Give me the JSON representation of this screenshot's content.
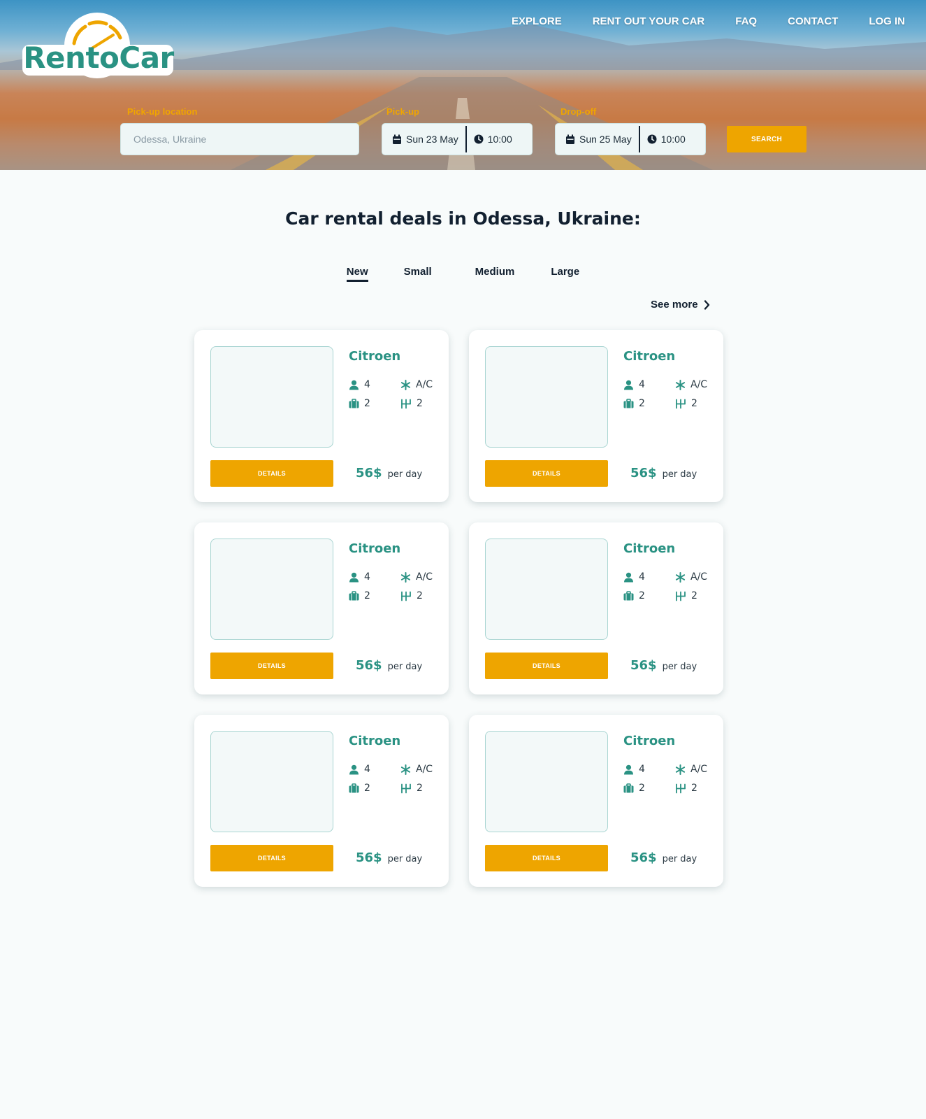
{
  "brand": {
    "name": "RentoCar"
  },
  "nav": {
    "items": [
      "EXPLORE",
      "RENT OUT YOUR CAR",
      "FAQ",
      "CONTACT",
      "LOG IN"
    ]
  },
  "search": {
    "pickup_location_label": "Pick-up location",
    "pickup_location_value": "Odessa, Ukraine",
    "pickup_label": "Pick-up",
    "pickup_date": "Sun 23 May",
    "pickup_time": "10:00",
    "dropoff_label": "Drop-off",
    "dropoff_date": "Sun 25 May",
    "dropoff_time": "10:00",
    "button_label": "SEARCH"
  },
  "main": {
    "heading": "Car rental deals in Odessa, Ukraine:",
    "tabs": [
      "New",
      "Small",
      "Medium",
      "Large"
    ],
    "active_tab": "New",
    "see_more": "See more"
  },
  "cars": [
    {
      "name": "Citroen",
      "seats": "4",
      "ac": "A/C",
      "bags": "2",
      "gears": "2",
      "details_label": "DETAILS",
      "price": "56$",
      "per": "per day"
    },
    {
      "name": "Citroen",
      "seats": "4",
      "ac": "A/C",
      "bags": "2",
      "gears": "2",
      "details_label": "DETAILS",
      "price": "56$",
      "per": "per day"
    },
    {
      "name": "Citroen",
      "seats": "4",
      "ac": "A/C",
      "bags": "2",
      "gears": "2",
      "details_label": "DETAILS",
      "price": "56$",
      "per": "per day"
    },
    {
      "name": "Citroen",
      "seats": "4",
      "ac": "A/C",
      "bags": "2",
      "gears": "2",
      "details_label": "DETAILS",
      "price": "56$",
      "per": "per day"
    },
    {
      "name": "Citroen",
      "seats": "4",
      "ac": "A/C",
      "bags": "2",
      "gears": "2",
      "details_label": "DETAILS",
      "price": "56$",
      "per": "per day"
    },
    {
      "name": "Citroen",
      "seats": "4",
      "ac": "A/C",
      "bags": "2",
      "gears": "2",
      "details_label": "DETAILS",
      "price": "56$",
      "per": "per day"
    }
  ],
  "colors": {
    "brand_teal": "#2a9283",
    "accent_orange": "#eea500",
    "text_dark": "#122030"
  }
}
